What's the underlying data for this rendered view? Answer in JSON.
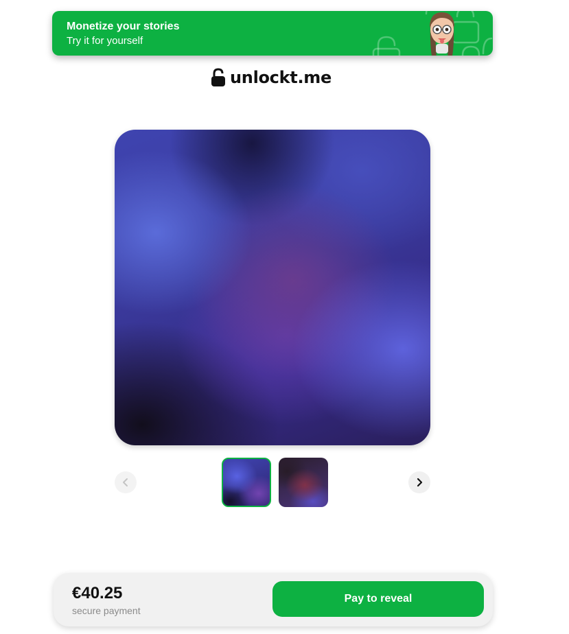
{
  "promo_banner": {
    "title": "Monetize your stories",
    "subtitle": "Try it for yourself"
  },
  "brand": {
    "name": "unlockt.me",
    "icon": "padlock-icon"
  },
  "media": {
    "main_image": "blurred-locked-image",
    "thumbnails": [
      {
        "name": "thumbnail-1",
        "selected": true
      },
      {
        "name": "thumbnail-2",
        "selected": false
      }
    ],
    "prev_icon": "chevron-left-icon",
    "next_icon": "chevron-right-icon"
  },
  "payment": {
    "price": "€40.25",
    "note": "secure payment",
    "button_label": "Pay to reveal"
  },
  "colors": {
    "accent": "#0db142",
    "pay_bar_bg": "#f1f1f1",
    "text_primary": "#111111",
    "text_muted": "#8a8a8a"
  }
}
